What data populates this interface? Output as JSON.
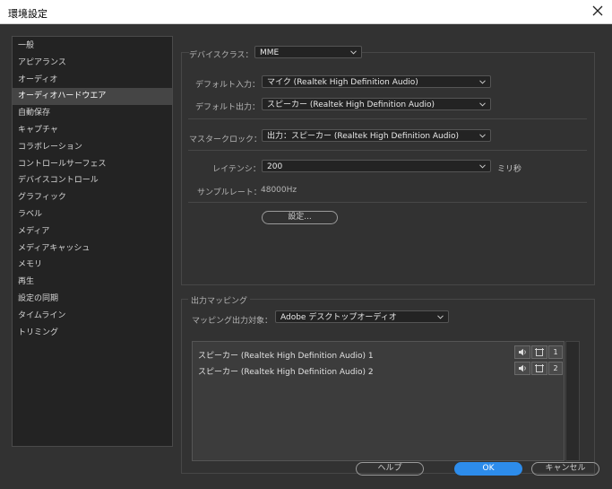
{
  "window": {
    "title": "環境設定"
  },
  "sidebar": {
    "items": [
      {
        "label": "一般"
      },
      {
        "label": "アピアランス"
      },
      {
        "label": "オーディオ"
      },
      {
        "label": "オーディオハードウエア",
        "selected": true
      },
      {
        "label": "自動保存"
      },
      {
        "label": "キャプチャ"
      },
      {
        "label": "コラボレーション"
      },
      {
        "label": "コントロールサーフェス"
      },
      {
        "label": "デバイスコントロール"
      },
      {
        "label": "グラフィック"
      },
      {
        "label": "ラベル"
      },
      {
        "label": "メディア"
      },
      {
        "label": "メディアキャッシュ"
      },
      {
        "label": "メモリ"
      },
      {
        "label": "再生"
      },
      {
        "label": "設定の同期"
      },
      {
        "label": "タイムライン"
      },
      {
        "label": "トリミング"
      }
    ]
  },
  "device_class": {
    "label": "デバイスクラス：",
    "value": "MME"
  },
  "default_input": {
    "label": "デフォルト入力：",
    "value": "マイク (Realtek High Definition Audio)"
  },
  "default_output": {
    "label": "デフォルト出力：",
    "value": "スピーカー (Realtek High Definition Audio)"
  },
  "master_clock": {
    "label": "マスタークロック：",
    "value": "出力：スピーカー (Realtek High Definition Audio)"
  },
  "latency": {
    "label": "レイテンシ：",
    "value": "200",
    "unit": "ミリ秒"
  },
  "sample_rate": {
    "label": "サンプルレート：",
    "value": "48000Hz"
  },
  "settings_button": "設定...",
  "output_mapping": {
    "section_label": "出力マッピング",
    "target_label": "マッピング出力対象：",
    "target_value": "Adobe デスクトップオーディオ",
    "channels": [
      {
        "label": "スピーカー (Realtek High Definition Audio) 1",
        "number": "1"
      },
      {
        "label": "スピーカー (Realtek High Definition Audio) 2",
        "number": "2"
      }
    ]
  },
  "footer": {
    "help": "ヘルプ",
    "ok": "OK",
    "cancel": "キャンセル"
  },
  "colors": {
    "accent": "#2d8ceb",
    "background": "#323232",
    "panel": "#232323"
  }
}
